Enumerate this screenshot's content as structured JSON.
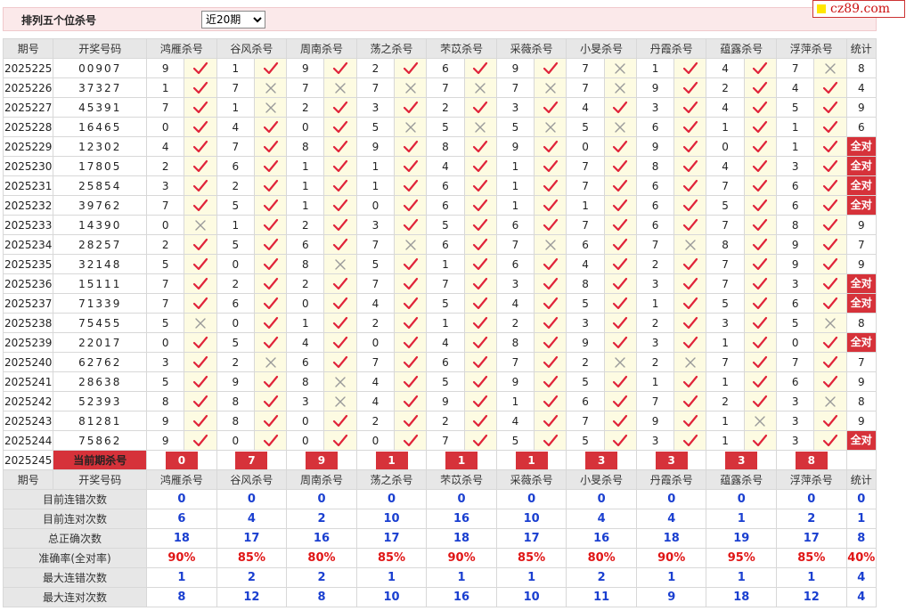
{
  "header": {
    "title": "排列五个位杀号",
    "range_selected": "近20期"
  },
  "logo": {
    "text": "cz89.com"
  },
  "columns": {
    "period": "期号",
    "draw": "开奖号码",
    "stat": "统计",
    "experts": [
      "鸿雁杀号",
      "谷风杀号",
      "周南杀号",
      "荡之杀号",
      "芣苡杀号",
      "采薇杀号",
      "小旻杀号",
      "丹霞杀号",
      "蕴露杀号",
      "浮萍杀号"
    ]
  },
  "rows": [
    {
      "p": "2025225",
      "d": "00907",
      "k": [
        "9",
        "1",
        "9",
        "2",
        "6",
        "9",
        "7",
        "1",
        "4",
        "7"
      ],
      "r": [
        1,
        1,
        1,
        1,
        1,
        1,
        0,
        1,
        1,
        0
      ],
      "s": "8"
    },
    {
      "p": "2025226",
      "d": "37327",
      "k": [
        "1",
        "7",
        "7",
        "7",
        "7",
        "7",
        "7",
        "9",
        "2",
        "4"
      ],
      "r": [
        1,
        0,
        0,
        0,
        0,
        0,
        0,
        1,
        1,
        1
      ],
      "s": "4"
    },
    {
      "p": "2025227",
      "d": "45391",
      "k": [
        "7",
        "1",
        "2",
        "3",
        "2",
        "3",
        "4",
        "3",
        "4",
        "5"
      ],
      "r": [
        1,
        0,
        1,
        1,
        1,
        1,
        1,
        1,
        1,
        1
      ],
      "s": "9"
    },
    {
      "p": "2025228",
      "d": "16465",
      "k": [
        "0",
        "4",
        "0",
        "5",
        "5",
        "5",
        "5",
        "6",
        "1",
        "1"
      ],
      "r": [
        1,
        1,
        1,
        0,
        0,
        0,
        0,
        1,
        1,
        1
      ],
      "s": "6"
    },
    {
      "p": "2025229",
      "d": "12302",
      "k": [
        "4",
        "7",
        "8",
        "9",
        "8",
        "9",
        "0",
        "9",
        "0",
        "1"
      ],
      "r": [
        1,
        1,
        1,
        1,
        1,
        1,
        1,
        1,
        1,
        1
      ],
      "s": "全对"
    },
    {
      "p": "2025230",
      "d": "17805",
      "k": [
        "2",
        "6",
        "1",
        "1",
        "4",
        "1",
        "7",
        "8",
        "4",
        "3"
      ],
      "r": [
        1,
        1,
        1,
        1,
        1,
        1,
        1,
        1,
        1,
        1
      ],
      "s": "全对"
    },
    {
      "p": "2025231",
      "d": "25854",
      "k": [
        "3",
        "2",
        "1",
        "1",
        "6",
        "1",
        "7",
        "6",
        "7",
        "6"
      ],
      "r": [
        1,
        1,
        1,
        1,
        1,
        1,
        1,
        1,
        1,
        1
      ],
      "s": "全对"
    },
    {
      "p": "2025232",
      "d": "39762",
      "k": [
        "7",
        "5",
        "1",
        "0",
        "6",
        "1",
        "1",
        "6",
        "5",
        "6"
      ],
      "r": [
        1,
        1,
        1,
        1,
        1,
        1,
        1,
        1,
        1,
        1
      ],
      "s": "全对"
    },
    {
      "p": "2025233",
      "d": "14390",
      "k": [
        "0",
        "1",
        "2",
        "3",
        "5",
        "6",
        "7",
        "6",
        "7",
        "8"
      ],
      "r": [
        0,
        1,
        1,
        1,
        1,
        1,
        1,
        1,
        1,
        1
      ],
      "s": "9"
    },
    {
      "p": "2025234",
      "d": "28257",
      "k": [
        "2",
        "5",
        "6",
        "7",
        "6",
        "7",
        "6",
        "7",
        "8",
        "9"
      ],
      "r": [
        1,
        1,
        1,
        0,
        1,
        0,
        1,
        0,
        1,
        1
      ],
      "s": "7"
    },
    {
      "p": "2025235",
      "d": "32148",
      "k": [
        "5",
        "0",
        "8",
        "5",
        "1",
        "6",
        "4",
        "2",
        "7",
        "9"
      ],
      "r": [
        1,
        1,
        0,
        1,
        1,
        1,
        1,
        1,
        1,
        1
      ],
      "s": "9"
    },
    {
      "p": "2025236",
      "d": "15111",
      "k": [
        "7",
        "2",
        "2",
        "7",
        "7",
        "3",
        "8",
        "3",
        "7",
        "3"
      ],
      "r": [
        1,
        1,
        1,
        1,
        1,
        1,
        1,
        1,
        1,
        1
      ],
      "s": "全对"
    },
    {
      "p": "2025237",
      "d": "71339",
      "k": [
        "7",
        "6",
        "0",
        "4",
        "5",
        "4",
        "5",
        "1",
        "5",
        "6"
      ],
      "r": [
        1,
        1,
        1,
        1,
        1,
        1,
        1,
        1,
        1,
        1
      ],
      "s": "全对"
    },
    {
      "p": "2025238",
      "d": "75455",
      "k": [
        "5",
        "0",
        "1",
        "2",
        "1",
        "2",
        "3",
        "2",
        "3",
        "5"
      ],
      "r": [
        0,
        1,
        1,
        1,
        1,
        1,
        1,
        1,
        1,
        0
      ],
      "s": "8"
    },
    {
      "p": "2025239",
      "d": "22017",
      "k": [
        "0",
        "5",
        "4",
        "0",
        "4",
        "8",
        "9",
        "3",
        "1",
        "0"
      ],
      "r": [
        1,
        1,
        1,
        1,
        1,
        1,
        1,
        1,
        1,
        1
      ],
      "s": "全对"
    },
    {
      "p": "2025240",
      "d": "62762",
      "k": [
        "3",
        "2",
        "6",
        "7",
        "6",
        "7",
        "2",
        "2",
        "7",
        "7"
      ],
      "r": [
        1,
        0,
        1,
        1,
        1,
        1,
        0,
        0,
        1,
        1
      ],
      "s": "7"
    },
    {
      "p": "2025241",
      "d": "28638",
      "k": [
        "5",
        "9",
        "8",
        "4",
        "5",
        "9",
        "5",
        "1",
        "1",
        "6"
      ],
      "r": [
        1,
        1,
        0,
        1,
        1,
        1,
        1,
        1,
        1,
        1
      ],
      "s": "9"
    },
    {
      "p": "2025242",
      "d": "52393",
      "k": [
        "8",
        "8",
        "3",
        "4",
        "9",
        "1",
        "6",
        "7",
        "2",
        "3"
      ],
      "r": [
        1,
        1,
        0,
        1,
        1,
        1,
        1,
        1,
        1,
        0
      ],
      "s": "8"
    },
    {
      "p": "2025243",
      "d": "81281",
      "k": [
        "9",
        "8",
        "0",
        "2",
        "2",
        "4",
        "7",
        "9",
        "1",
        "3"
      ],
      "r": [
        1,
        1,
        1,
        1,
        1,
        1,
        1,
        1,
        0,
        1
      ],
      "s": "9"
    },
    {
      "p": "2025244",
      "d": "75862",
      "k": [
        "9",
        "0",
        "0",
        "0",
        "7",
        "5",
        "5",
        "3",
        "1",
        "3"
      ],
      "r": [
        1,
        1,
        1,
        1,
        1,
        1,
        1,
        1,
        1,
        1
      ],
      "s": "全对"
    }
  ],
  "current": {
    "p": "2025245",
    "label": "当前期杀号",
    "k": [
      "0",
      "7",
      "9",
      "1",
      "1",
      "1",
      "3",
      "3",
      "3",
      "8"
    ]
  },
  "stats": [
    {
      "label": "目前连错次数",
      "v": [
        "0",
        "0",
        "0",
        "0",
        "0",
        "0",
        "0",
        "0",
        "0",
        "0",
        "0"
      ],
      "red": false
    },
    {
      "label": "目前连对次数",
      "v": [
        "6",
        "4",
        "2",
        "10",
        "16",
        "10",
        "4",
        "4",
        "1",
        "2",
        "1"
      ],
      "red": false
    },
    {
      "label": "总正确次数",
      "v": [
        "18",
        "17",
        "16",
        "17",
        "18",
        "17",
        "16",
        "18",
        "19",
        "17",
        "8"
      ],
      "red": false
    },
    {
      "label": "准确率(全对率)",
      "v": [
        "90%",
        "85%",
        "80%",
        "85%",
        "90%",
        "85%",
        "80%",
        "90%",
        "95%",
        "85%",
        "40%"
      ],
      "red": true
    },
    {
      "label": "最大连错次数",
      "v": [
        "1",
        "2",
        "2",
        "1",
        "1",
        "1",
        "2",
        "1",
        "1",
        "1",
        "4"
      ],
      "red": false
    },
    {
      "label": "最大连对次数",
      "v": [
        "8",
        "12",
        "8",
        "10",
        "16",
        "10",
        "11",
        "9",
        "18",
        "12",
        "4"
      ],
      "red": false
    }
  ],
  "colors": {
    "accent": "#d6323a",
    "check": "#e0243a",
    "cross": "#9a9a9a",
    "mark_bg": "#fdfbe2",
    "header_bg": "#e7e7e7",
    "stat_blue": "#1a3fd0"
  }
}
